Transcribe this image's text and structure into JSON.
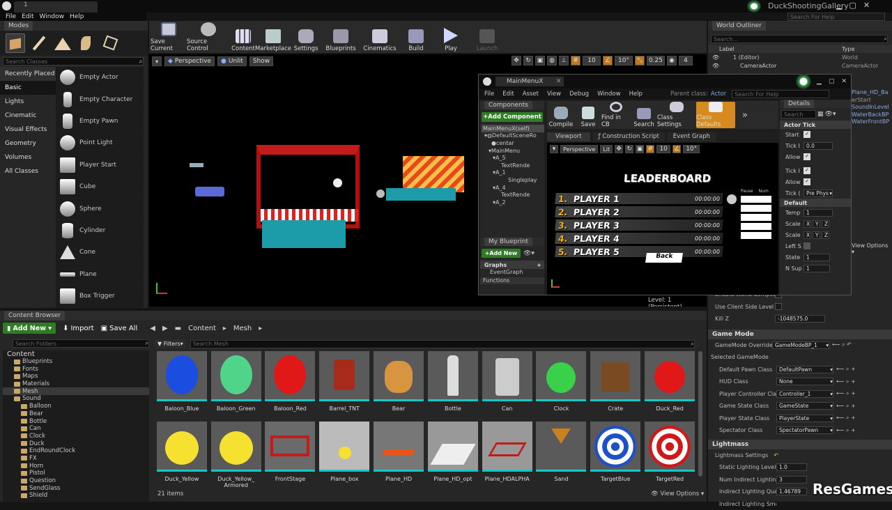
{
  "app": {
    "project": "DuckShootingGallery",
    "search_help": "Search For Help",
    "tab": "1"
  },
  "menu": [
    "File",
    "Edit",
    "Window",
    "Help"
  ],
  "modes": {
    "title": "Modes",
    "search": "Search Classes",
    "categories": [
      "Recently Placed",
      "Basic",
      "Lights",
      "Cinematic",
      "Visual Effects",
      "Geometry",
      "Volumes",
      "All Classes"
    ],
    "items": [
      "Empty Actor",
      "Empty Character",
      "Empty Pawn",
      "Point Light",
      "Player Start",
      "Cube",
      "Sphere",
      "Cylinder",
      "Cone",
      "Plane",
      "Box Trigger"
    ]
  },
  "toolbar": [
    "Save Current",
    "Source Control",
    "Content",
    "Marketplace",
    "Settings",
    "Blueprints",
    "Cinematics",
    "Build",
    "Play",
    "Launch"
  ],
  "viewport": {
    "perspective": "Perspective",
    "unlit": "Unlit",
    "show": "Show",
    "grid": "10",
    "angle": "10°",
    "scale": "0.25",
    "cam": "4",
    "level_label": "Level:",
    "level_value": "1 (Persistent)"
  },
  "outliner": {
    "title": "World Outliner",
    "search": "Search...",
    "col_label": "Label",
    "col_type": "Type",
    "rows": [
      {
        "label": "1 (Editor)",
        "type": "World"
      },
      {
        "label": "CameraActor",
        "type": "CameraActor"
      }
    ],
    "right_items": [
      "Plane_HD_Ba",
      "erStart",
      "SoundInLevel",
      "WaterBackBP",
      "WaterFrontBP"
    ],
    "view_options": "View Options"
  },
  "bp": {
    "tab": "MainMenuX",
    "menu": [
      "File",
      "Edit",
      "Asset",
      "View",
      "Debug",
      "Window",
      "Help"
    ],
    "parent_label": "Parent class:",
    "parent_value": "Actor",
    "search_help": "Search For Help",
    "components_title": "Components",
    "add_component": "+Add Component",
    "comp_tree": [
      "MainMenuX(self)",
      "DefaultSceneRo",
      "centar",
      "MainMenu",
      "A_5",
      "TextRende",
      "A_1",
      "Singleplay",
      "A_4",
      "TextRende",
      "A_2"
    ],
    "toolbar": [
      "Compile",
      "Save",
      "Find in CB",
      "Search",
      "Class Settings",
      "Class Defaults"
    ],
    "tabs": [
      "Viewport",
      "Construction Script",
      "Event Graph"
    ],
    "vp": {
      "perspective": "Perspective",
      "lit": "Lit",
      "grid": "10",
      "angle": "10°"
    },
    "my_blueprint": "My Blueprint",
    "add_new": "+Add New",
    "graphs": "Graphs",
    "event_graph": "EventGraph",
    "functions": "Functions",
    "details_title": "Details",
    "details_search": "Search",
    "actor_tick": "Actor Tick",
    "start": "Start",
    "tick_i": "Tick I",
    "tick_i_val": "0.0",
    "allow": "Allow",
    "tick2": "Tick I",
    "allow2": "Allow",
    "tick_g": "Tick (",
    "tick_g_val": "Pre Phys",
    "default": "Default",
    "temp": "Temp",
    "temp_val": "1",
    "scale1": "Scale",
    "scale2": "Scale",
    "xyz": [
      "X",
      "Y",
      "Z"
    ],
    "lefts": "Left S",
    "state": "State",
    "state_val": "1",
    "nsup": "N Sup",
    "nsup_val": "1",
    "leaderboard": {
      "title": "LEADERBOARD",
      "players": [
        {
          "rank": "1.",
          "name": "PLAYER 1",
          "time": "00:00:00"
        },
        {
          "rank": "2.",
          "name": "PLAYER 2",
          "time": "00:00:00"
        },
        {
          "rank": "3.",
          "name": "PLAYER 3",
          "time": "00:00:00"
        },
        {
          "rank": "4.",
          "name": "PLAYER 4",
          "time": "00:00:00"
        },
        {
          "rank": "5.",
          "name": "PLAYER 5",
          "time": "00:00:00"
        }
      ],
      "back": "Back",
      "col1": "Pause",
      "col2": "Num"
    }
  },
  "world": {
    "enable_comp": "Enable World Compos",
    "client_side": "Use Client Side Level S",
    "kill_z": "Kill Z",
    "kill_z_val": "-1048575.0",
    "game_mode": "Game Mode",
    "gm_override": "GameMode Override",
    "gm_override_val": "GameModeBP_1",
    "selected_gm": "Selected GameMode",
    "props": [
      {
        "l": "Default Pawn Class",
        "v": "DefaultPawn"
      },
      {
        "l": "HUD Class",
        "v": "None"
      },
      {
        "l": "Player Controller Cla",
        "v": "Controller_1"
      },
      {
        "l": "Game State Class",
        "v": "GameState"
      },
      {
        "l": "Player State Class",
        "v": "PlayerState"
      },
      {
        "l": "Spectator Class",
        "v": "SpectatorPawn"
      }
    ],
    "lightmass": "Lightmass",
    "lm_settings": "Lightmass Settings",
    "lm_props": [
      {
        "l": "Static Lighting Level",
        "v": "1.0"
      },
      {
        "l": "Num Indirect Lightin",
        "v": "3"
      },
      {
        "l": "Indirect Lighting Qua",
        "v": "1.46789"
      },
      {
        "l": "Indirect Lighting Smo",
        "v": ""
      }
    ]
  },
  "content": {
    "title": "Content Browser",
    "add_new": "Add New",
    "import": "Import",
    "save_all": "Save All",
    "path": [
      "Content",
      "Mesh"
    ],
    "search_folders": "Search Folders",
    "filters": "Filters",
    "search_mesh": "Search Mesh",
    "count": "21 items",
    "view_options": "View Options",
    "folders": [
      {
        "n": "Content",
        "d": 0
      },
      {
        "n": "Blueprints",
        "d": 1
      },
      {
        "n": "Fonts",
        "d": 1
      },
      {
        "n": "Maps",
        "d": 1
      },
      {
        "n": "Materials",
        "d": 1
      },
      {
        "n": "Mesh",
        "d": 1
      },
      {
        "n": "Sound",
        "d": 1
      },
      {
        "n": "Balloon",
        "d": 2
      },
      {
        "n": "Bear",
        "d": 2
      },
      {
        "n": "Bottle",
        "d": 2
      },
      {
        "n": "Can",
        "d": 2
      },
      {
        "n": "Clock",
        "d": 2
      },
      {
        "n": "Duck",
        "d": 2
      },
      {
        "n": "EndRoundClock",
        "d": 2
      },
      {
        "n": "FX",
        "d": 2
      },
      {
        "n": "Horn",
        "d": 2
      },
      {
        "n": "Pistol",
        "d": 2
      },
      {
        "n": "Question",
        "d": 2
      },
      {
        "n": "SendGlass",
        "d": 2
      },
      {
        "n": "Shield",
        "d": 2
      }
    ],
    "assets": [
      "Baloon_Blue",
      "Baloon_Green",
      "Baloon_Red",
      "Barrel_TNT",
      "Bear",
      "Bottle",
      "Can",
      "Clock",
      "Crate",
      "Duck_Red",
      "Duck_Yellow",
      "Duck_Yellow_\nArmored",
      "FrontStage",
      "Plane_box",
      "Plane_HD",
      "Plane_HD_opt",
      "Plane_HDALPHA",
      "Sand",
      "TargetBlue",
      "TargetRed"
    ]
  },
  "watermark": "ResGames"
}
